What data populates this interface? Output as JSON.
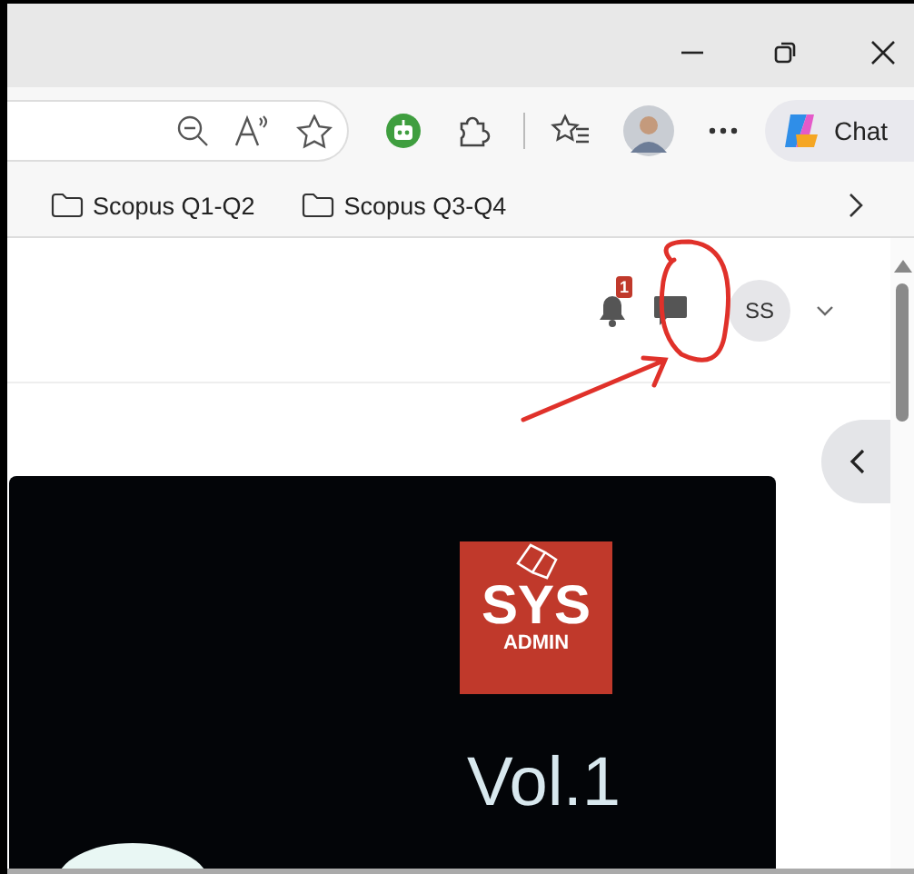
{
  "toolbar": {
    "chat_label": "Chat"
  },
  "bookmarks": [
    {
      "label": "Scopus Q1-Q2"
    },
    {
      "label": "Scopus Q3-Q4"
    }
  ],
  "header": {
    "notification_count": "1",
    "avatar_initials": "SS"
  },
  "cover": {
    "logo_title": "SYS",
    "logo_subtitle": "ADMIN",
    "volume": "Vol.1"
  }
}
